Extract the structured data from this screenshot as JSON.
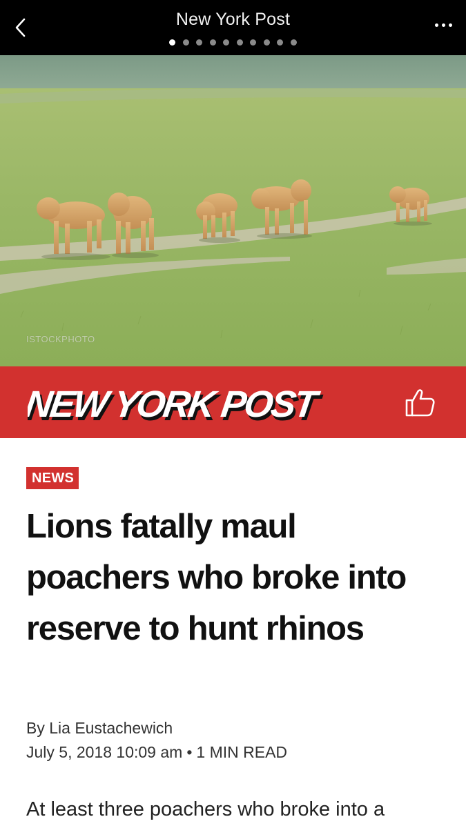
{
  "nav": {
    "title": "New York Post",
    "page_count": 10,
    "current_page": 1
  },
  "hero": {
    "credit": "ISTOCKPHOTO"
  },
  "brand": {
    "logo_text": "NEW YORK POST",
    "color": "#d2312f"
  },
  "article": {
    "tag": "NEWS",
    "headline": "Lions fatally maul poachers who broke into reserve to hunt rhinos",
    "byline": "By Lia Eustachewich",
    "date": "July 5, 2018 10:09 am",
    "read_time": "1 MIN READ",
    "body_preview": "At least three poachers who broke into a"
  },
  "icons": {
    "back": "chevron-left-icon",
    "more": "more-horizontal-icon",
    "like": "thumbs-up-icon"
  }
}
